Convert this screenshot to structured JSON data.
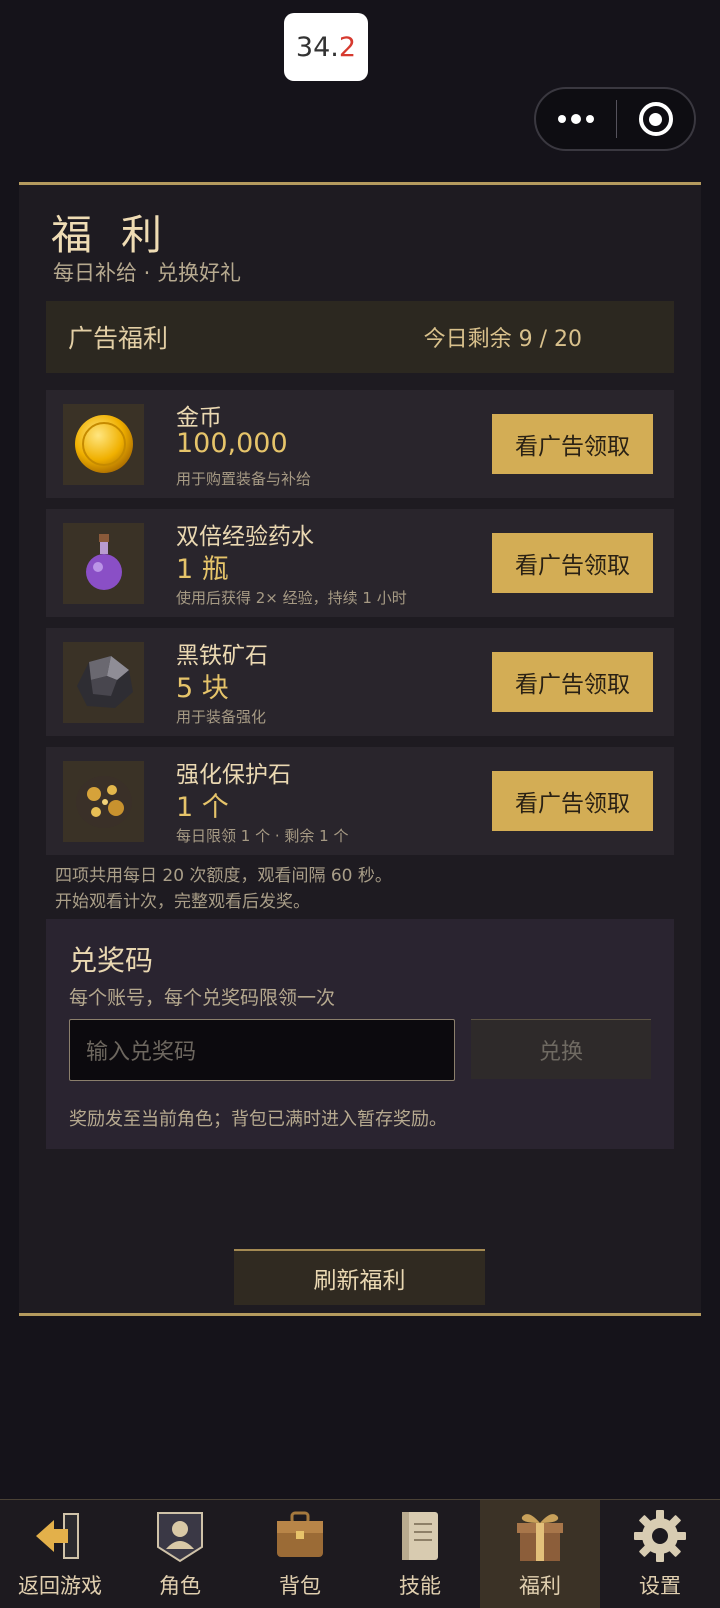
{
  "status": {
    "fps_main": "34.",
    "fps_red": "2"
  },
  "panel": {
    "title": "福 利",
    "subtitle": "每日补给 · 兑换好礼",
    "ads": {
      "header": "广告福利",
      "remaining": "今日剩余 9 / 20",
      "items": [
        {
          "name": "金币",
          "qty": "100,000",
          "desc": "用于购置装备与补给",
          "button": "看广告领取",
          "icon": "gold-coin-icon"
        },
        {
          "name": "双倍经验药水",
          "qty": "1 瓶",
          "desc": "使用后获得 2× 经验，持续 1 小时",
          "button": "看广告领取",
          "icon": "potion-icon"
        },
        {
          "name": "黑铁矿石",
          "qty": "5 块",
          "desc": "用于装备强化",
          "button": "看广告领取",
          "icon": "iron-ore-icon"
        },
        {
          "name": "强化保护石",
          "qty": "1 个",
          "desc": "每日限领 1 个 · 剩余 1 个",
          "button": "看广告领取",
          "icon": "protect-stone-icon"
        }
      ],
      "note_line1": "四项共用每日 20 次额度，观看间隔 60 秒。",
      "note_line2": "开始观看计次，完整观看后发奖。"
    },
    "redeem": {
      "title": "兑奖码",
      "subtitle": "每个账号，每个兑奖码限领一次",
      "placeholder": "输入兑奖码",
      "button": "兑换",
      "note": "奖励发至当前角色；背包已满时进入暂存奖励。"
    },
    "refresh": "刷新福利"
  },
  "nav": [
    {
      "label": "返回游戏",
      "icon": "back-arrow-icon"
    },
    {
      "label": "角色",
      "icon": "character-icon"
    },
    {
      "label": "背包",
      "icon": "bag-icon"
    },
    {
      "label": "技能",
      "icon": "book-icon"
    },
    {
      "label": "福利",
      "icon": "gift-icon",
      "active": true
    },
    {
      "label": "设置",
      "icon": "gear-icon"
    }
  ],
  "colors": {
    "accent_gold": "#d3ad55",
    "panel_border": "#b49a5e",
    "background": "#15131a"
  }
}
